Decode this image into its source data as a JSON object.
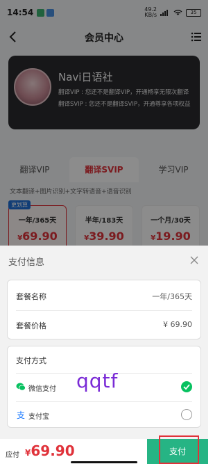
{
  "status_bar": {
    "time": "14:54",
    "net_speed": "49.2\nKB/s",
    "battery": "35"
  },
  "navbar": {
    "title": "会员中心"
  },
  "vip_card": {
    "name": "Navi日语社",
    "line1": "翻译VIP : 您还不是翻译VIP，开通畅享无限次翻译",
    "line2": "翻译SVIP : 您还不是翻译SVIP，开通尊享各项权益"
  },
  "tabs": [
    {
      "label": "翻译VIP",
      "active": false
    },
    {
      "label": "翻译SVIP",
      "active": true
    },
    {
      "label": "学习VIP",
      "active": false
    }
  ],
  "features_text": "文本翻译+图片识别+文字转语音+语音识别",
  "plans": [
    {
      "badge": "更划算",
      "name": "一年/365天",
      "currency": "¥",
      "price": "69.90",
      "selected": true
    },
    {
      "name": "半年/183天",
      "currency": "¥",
      "price": "39.90",
      "selected": false
    },
    {
      "name": "一个月/30天",
      "currency": "¥",
      "price": "19.90",
      "selected": false
    }
  ],
  "sheet": {
    "title": "支付信息",
    "package_name_label": "套餐名称",
    "package_name_value": "一年/365天",
    "package_price_label": "套餐价格",
    "package_price_value": "¥ 69.90",
    "payment_method_title": "支付方式",
    "methods": [
      {
        "label": "微信支付",
        "selected": true,
        "icon": "wechat-pay-icon"
      },
      {
        "label": "支付宝",
        "selected": false,
        "icon": "alipay-icon"
      }
    ],
    "watermark": "qqtf"
  },
  "footer": {
    "due_label": "应付",
    "currency": "¥",
    "amount": "69.90",
    "pay_label": "支付"
  },
  "colors": {
    "accent_red": "#e0323a",
    "pay_green": "#26b484",
    "wechat_green": "#07c160",
    "alipay_blue": "#1677ff"
  }
}
